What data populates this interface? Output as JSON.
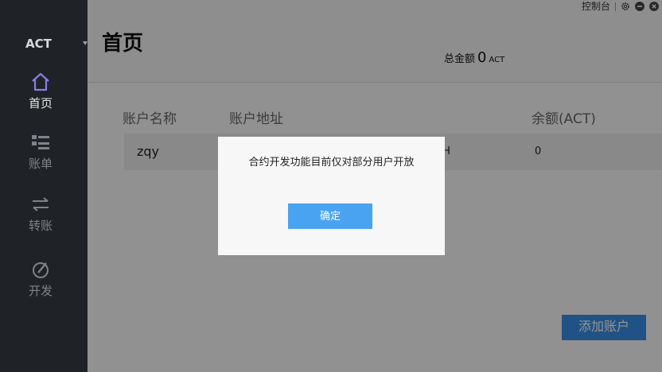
{
  "sidebar": {
    "brand": "ACT",
    "items": [
      {
        "label": "首页",
        "icon": "home-icon",
        "active": true
      },
      {
        "label": "账单",
        "icon": "list-icon",
        "active": false
      },
      {
        "label": "转账",
        "icon": "transfer-icon",
        "active": false
      },
      {
        "label": "开发",
        "icon": "develop-icon",
        "active": false
      }
    ]
  },
  "topbar": {
    "console_label": "控制台",
    "icons": [
      "gear-icon",
      "minimize-icon",
      "close-icon"
    ]
  },
  "header": {
    "title": "首页",
    "balance_label": "总金额",
    "balance_value": "0",
    "balance_unit": "ACT"
  },
  "accounts_table": {
    "columns": [
      "账户名称",
      "账户地址",
      "余额(ACT)"
    ],
    "rows": [
      {
        "name": "zqy",
        "address_fragment": "5H",
        "balance": "0"
      }
    ]
  },
  "add_account_label": "添加账户",
  "dialog": {
    "message": "合约开发功能目前仅对部分用户开放",
    "confirm_label": "确定"
  },
  "colors": {
    "sidebar_bg": "#1f2327",
    "accent": "#3a8ee6",
    "dialog_button": "#4aa3f0",
    "active_icon": "#8a7de6"
  }
}
